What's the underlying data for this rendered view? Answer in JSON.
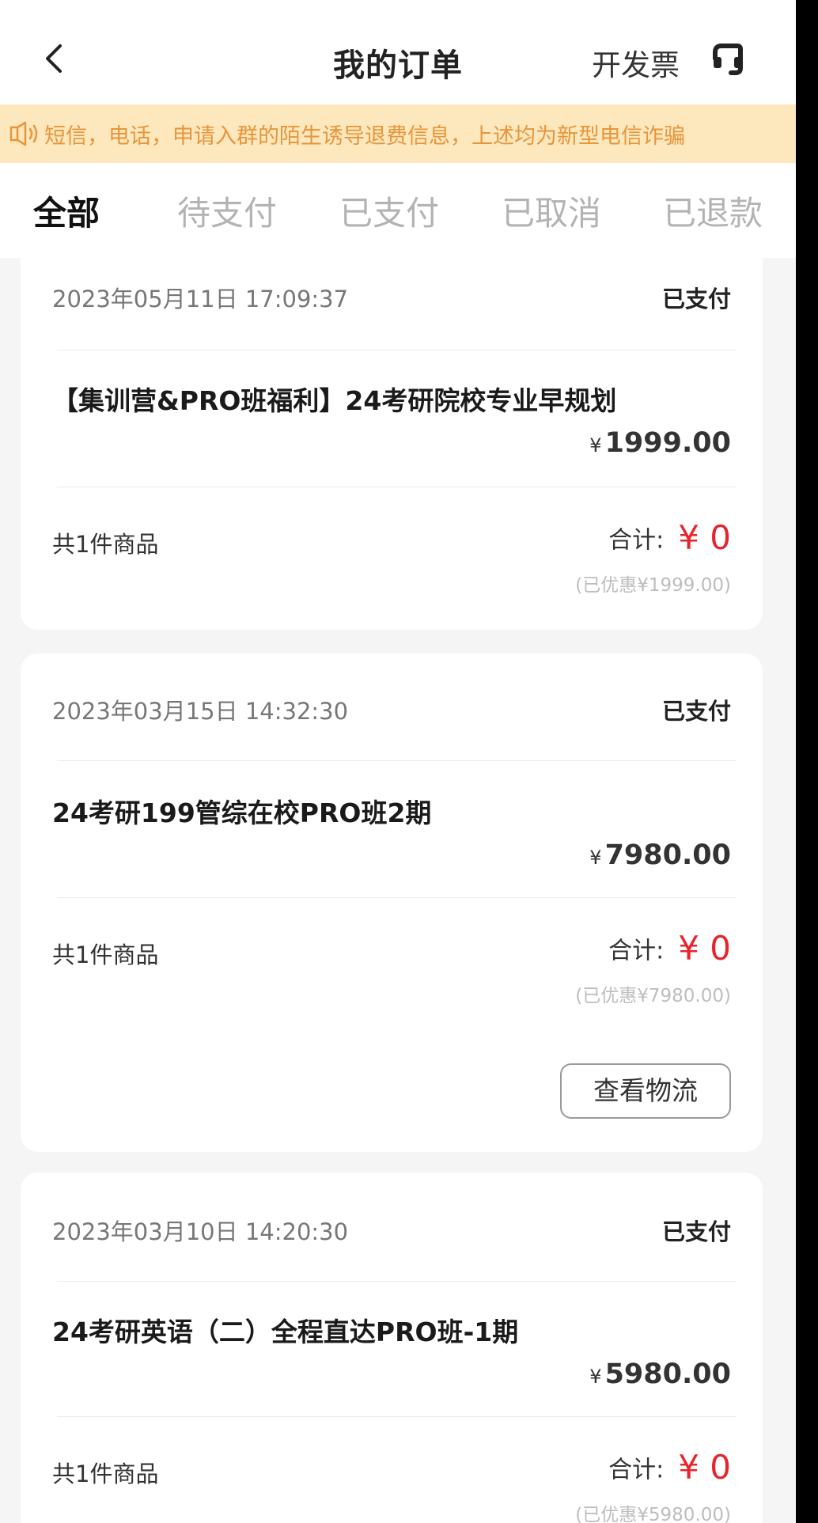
{
  "header": {
    "title": "我的订单",
    "invoice_label": "开发票"
  },
  "notice": {
    "text": "短信，电话，申请入群的陌生诱导退费信息，上述均为新型电信诈骗"
  },
  "tabs": [
    {
      "label": "全部",
      "active": true
    },
    {
      "label": "待支付",
      "active": false
    },
    {
      "label": "已支付",
      "active": false
    },
    {
      "label": "已取消",
      "active": false
    },
    {
      "label": "已退款",
      "active": false
    }
  ],
  "orders": [
    {
      "date": "2023年05月11日 17:09:37",
      "status": "已支付",
      "product": "【集训营&PRO班福利】24考研院校专业早规划",
      "currency": "¥",
      "price": "1999.00",
      "count": "共1件商品",
      "total_label": "合计:",
      "total": "¥ 0",
      "discount": "(已优惠¥1999.00)"
    },
    {
      "date": "2023年03月15日 14:32:30",
      "status": "已支付",
      "product": "24考研199管综在校PRO班2期",
      "currency": "¥",
      "price": "7980.00",
      "count": "共1件商品",
      "total_label": "合计:",
      "total": "¥ 0",
      "discount": "(已优惠¥7980.00)",
      "action": "查看物流"
    },
    {
      "date": "2023年03月10日 14:20:30",
      "status": "已支付",
      "product": "24考研英语（二）全程直达PRO班-1期",
      "currency": "¥",
      "price": "5980.00",
      "count": "共1件商品",
      "total_label": "合计:",
      "total": "¥ 0",
      "discount": "(已优惠¥5980.00)"
    }
  ],
  "colors": {
    "accent_red": "#e8232b",
    "notice_bg": "#fde7bd",
    "notice_text": "#e7963b"
  }
}
